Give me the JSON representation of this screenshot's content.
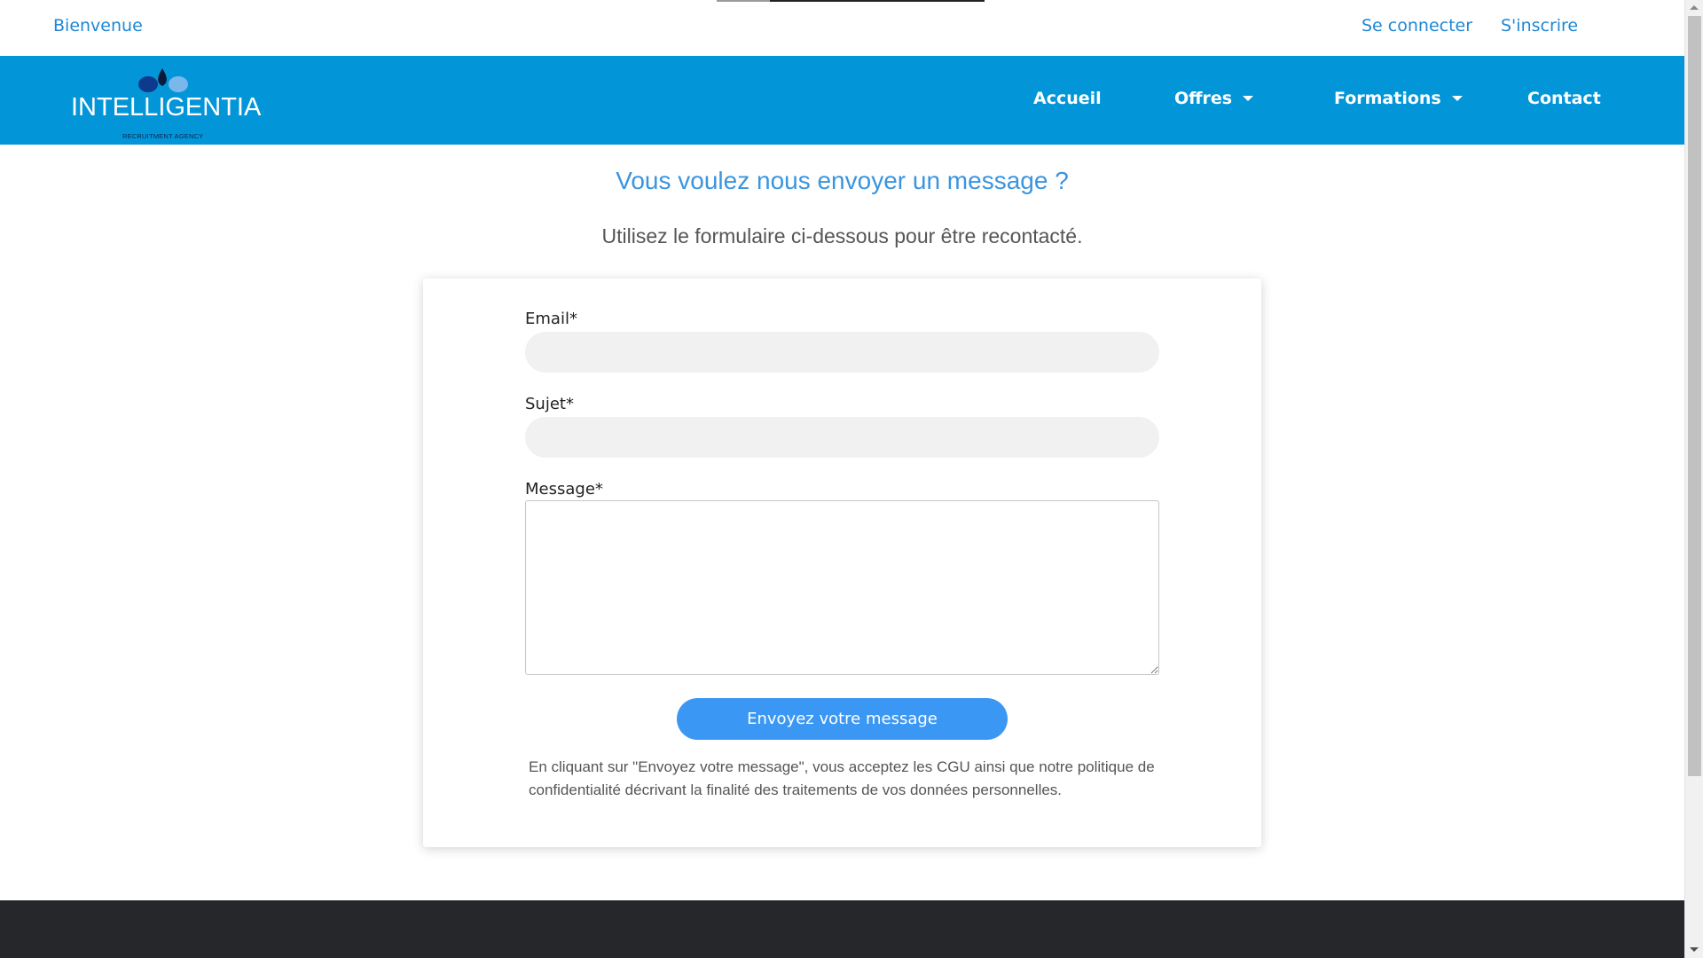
{
  "topbar": {
    "welcome": "Bienvenue",
    "login": "Se connecter",
    "signup": "S'inscrire"
  },
  "brand": {
    "name": "INTELLIGENTIA",
    "tagline": "RECRUITMENT AGENCY",
    "primary_color": "#0296d9",
    "logo_icon": "water-drops-logo"
  },
  "nav": {
    "items": [
      {
        "label": "Accueil",
        "dropdown": false
      },
      {
        "label": "Offres",
        "dropdown": true
      },
      {
        "label": "Formations",
        "dropdown": true
      },
      {
        "label": "Contact",
        "dropdown": false
      }
    ]
  },
  "main": {
    "heading": "Vous voulez nous envoyer un message ?",
    "subheading": "Utilisez le formulaire ci-dessous pour être recontacté."
  },
  "form": {
    "email_label": "Email*",
    "email_value": "",
    "subject_label": "Sujet*",
    "subject_value": "",
    "message_label": "Message*",
    "message_value": "",
    "submit_label": "Envoyez votre message",
    "submit_color": "#3b97f4",
    "disclaimer": "En cliquant sur \"Envoyez votre message\", vous acceptez les CGU ainsi que notre politique de confidentialité décrivant la finalité des traitements de vos données personnelles."
  },
  "footer": {
    "color": "#25272b"
  }
}
